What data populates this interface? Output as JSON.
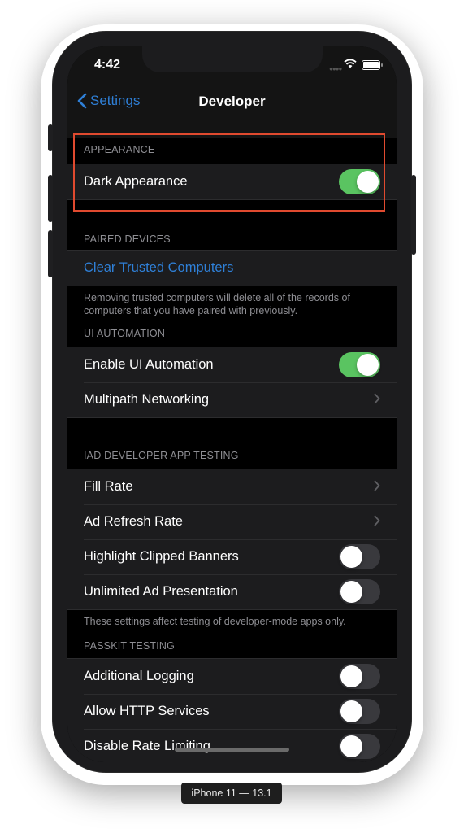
{
  "status_bar": {
    "time": "4:42"
  },
  "nav": {
    "back_label": "Settings",
    "title": "Developer"
  },
  "sections": {
    "appearance": {
      "header": "APPEARANCE",
      "rows": [
        {
          "label": "Dark Appearance",
          "control": "toggle",
          "on": true
        }
      ]
    },
    "paired_devices": {
      "header": "PAIRED DEVICES",
      "rows": [
        {
          "label": "Clear Trusted Computers",
          "control": "link"
        }
      ],
      "footer": "Removing trusted computers will delete all of the records of computers that you have paired with previously."
    },
    "ui_automation": {
      "header": "UI AUTOMATION",
      "rows": [
        {
          "label": "Enable UI Automation",
          "control": "toggle",
          "on": true
        },
        {
          "label": "Multipath Networking",
          "control": "chevron"
        }
      ]
    },
    "iad": {
      "header": "IAD DEVELOPER APP TESTING",
      "rows": [
        {
          "label": "Fill Rate",
          "control": "chevron"
        },
        {
          "label": "Ad Refresh Rate",
          "control": "chevron"
        },
        {
          "label": "Highlight Clipped Banners",
          "control": "toggle",
          "on": false
        },
        {
          "label": "Unlimited Ad Presentation",
          "control": "toggle",
          "on": false
        }
      ],
      "footer": "These settings affect testing of developer-mode apps only."
    },
    "passkit": {
      "header": "PASSKIT TESTING",
      "rows": [
        {
          "label": "Additional Logging",
          "control": "toggle",
          "on": false
        },
        {
          "label": "Allow HTTP Services",
          "control": "toggle",
          "on": false
        },
        {
          "label": "Disable Rate Limiting",
          "control": "toggle",
          "on": false
        }
      ]
    }
  },
  "device_label": "iPhone 11 — 13.1",
  "colors": {
    "accent": "#2f80d8",
    "toggle_on": "#5ac461",
    "highlight": "#e04a2f"
  }
}
